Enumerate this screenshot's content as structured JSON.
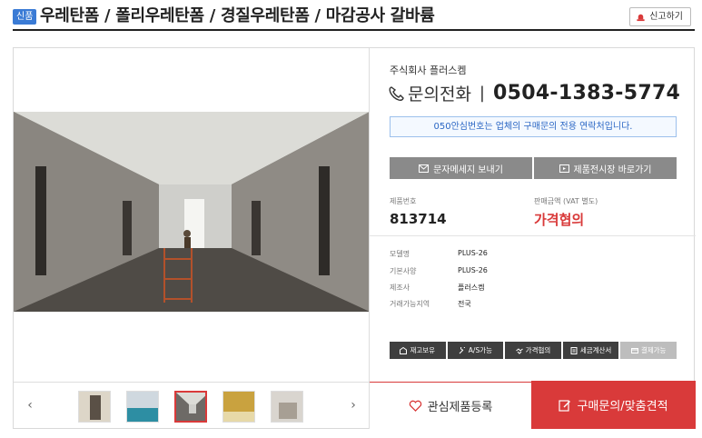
{
  "header": {
    "badge": "신품",
    "title": "우레탄폼 / 폴리우레탄폼 / 경질우레탄폼 / 마감공사 갈바륨",
    "report_label": "신고하기"
  },
  "seller": {
    "company": "주식회사 플러스켐",
    "phone_label": "문의전화",
    "phone_sep": "|",
    "phone_number": "0504-1383-5774",
    "notice": "050안심번호는 업체의 구매문의 전용 연락처입니다."
  },
  "actions": {
    "sms_label": "문자메세지 보내기",
    "showroom_label": "제품전시장 바로가기"
  },
  "product": {
    "id_label": "제품번호",
    "id_value": "813714",
    "price_label": "판매금액 (VAT 별도)",
    "price_value": "가격협의"
  },
  "specs": [
    {
      "label": "모델명",
      "value": "PLUS-26"
    },
    {
      "label": "기본사양",
      "value": "PLUS-26"
    },
    {
      "label": "제조사",
      "value": "플러스켐"
    },
    {
      "label": "거래가능지역",
      "value": "전국"
    }
  ],
  "features": [
    {
      "label": "재고보유",
      "icon": "warehouse-icon",
      "enabled": true
    },
    {
      "label": "A/S가능",
      "icon": "wrench-icon",
      "enabled": true
    },
    {
      "label": "가격협의",
      "icon": "handshake-icon",
      "enabled": true
    },
    {
      "label": "세금계산서",
      "icon": "receipt-icon",
      "enabled": true
    },
    {
      "label": "결제가능",
      "icon": "card-icon",
      "enabled": false
    }
  ],
  "gallery": {
    "prev": "‹",
    "next": "›",
    "selected_index": 2,
    "thumbnails": [
      "thumbnail-1",
      "thumbnail-2",
      "thumbnail-3",
      "thumbnail-4",
      "thumbnail-5"
    ]
  },
  "cta": {
    "favorite_label": "관심제품등록",
    "inquiry_label": "구매문의/맞춤견적"
  },
  "colors": {
    "accent_red": "#d93a3a",
    "notice_blue": "#2b67c4",
    "badge_blue": "#3a7bd5",
    "button_gray": "#8a8a8a",
    "feature_dark": "#3f3f3f"
  }
}
